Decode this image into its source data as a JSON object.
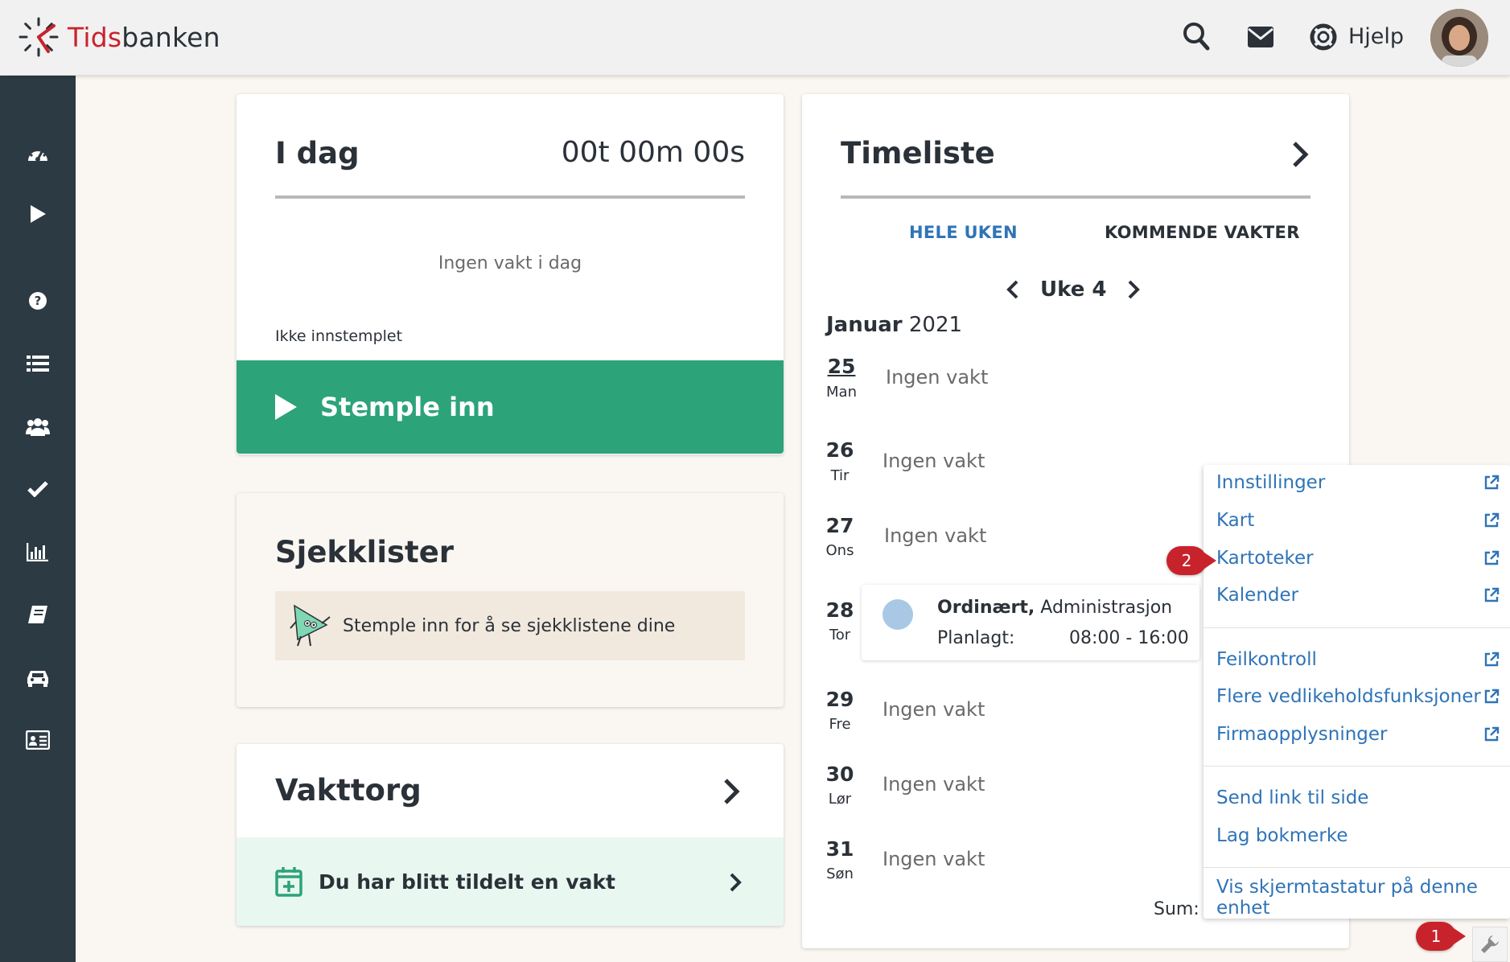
{
  "brand": {
    "part1": "Tids",
    "part2": "banken",
    "accent": "#c8232c"
  },
  "topbar": {
    "search_icon": "search-icon",
    "mail_icon": "envelope-icon",
    "help_icon": "lifebuoy-icon",
    "help_label": "Hjelp"
  },
  "sidebar": {
    "items": [
      {
        "icon": "dashboard-icon"
      },
      {
        "icon": "play-icon"
      },
      {
        "icon": "question-icon"
      },
      {
        "icon": "list-icon"
      },
      {
        "icon": "users-icon"
      },
      {
        "icon": "check-icon"
      },
      {
        "icon": "bar-chart-icon"
      },
      {
        "icon": "book-icon"
      },
      {
        "icon": "car-icon"
      },
      {
        "icon": "id-card-icon"
      }
    ],
    "color": "#2c3a44"
  },
  "idag": {
    "title": "I dag",
    "timer": "00t 00m 00s",
    "no_shift": "Ingen vakt i dag",
    "status": "Ikke innstemplet",
    "button": "Stemple inn",
    "button_color": "#2da37a"
  },
  "sjekklister": {
    "title": "Sjekklister",
    "message": "Stemple inn for å se sjekklistene dine"
  },
  "vakttorg": {
    "title": "Vakttorg",
    "assigned": "Du har blitt tildelt en vakt"
  },
  "timeliste": {
    "title": "Timeliste",
    "tabs": [
      {
        "label": "HELE UKEN",
        "active": true
      },
      {
        "label": "KOMMENDE VAKTER",
        "active": false
      }
    ],
    "week": "Uke 4",
    "month": "Januar",
    "year": "2021",
    "days": [
      {
        "num": "25",
        "name": "Man",
        "status": "Ingen vakt"
      },
      {
        "num": "26",
        "name": "Tir",
        "status": "Ingen vakt"
      },
      {
        "num": "27",
        "name": "Ons",
        "status": "Ingen vakt"
      },
      {
        "num": "28",
        "name": "Tor",
        "status": ""
      },
      {
        "num": "29",
        "name": "Fre",
        "status": "Ingen vakt"
      },
      {
        "num": "30",
        "name": "Lør",
        "status": "Ingen vakt"
      },
      {
        "num": "31",
        "name": "Søn",
        "status": "Ingen vakt"
      }
    ],
    "shift": {
      "type": "Ordinært,",
      "department": "Administrasjon",
      "plan_label": "Planlagt:",
      "plan_time": "08:00 - 16:00"
    },
    "sum_label": "Sum: ("
  },
  "menu": {
    "items": [
      {
        "label": "Innstillinger",
        "external": true
      },
      {
        "label": "Kart",
        "external": true
      },
      {
        "label": "Kartoteker",
        "external": true
      },
      {
        "label": "Kalender",
        "external": true
      },
      {
        "label": "Feilkontroll",
        "external": true
      },
      {
        "label": "Flere vedlikeholdsfunksjoner",
        "external": true
      },
      {
        "label": "Firmaopplysninger",
        "external": true
      },
      {
        "label": "Send link til side",
        "external": false
      },
      {
        "label": "Lag bokmerke",
        "external": false
      },
      {
        "label": "Vis skjermtastatur på denne enhet",
        "external": false
      }
    ],
    "link_color": "#2f74b7"
  },
  "annotations": {
    "badge1": "1",
    "badge2": "2"
  },
  "tool_icon": "wrench-icon"
}
